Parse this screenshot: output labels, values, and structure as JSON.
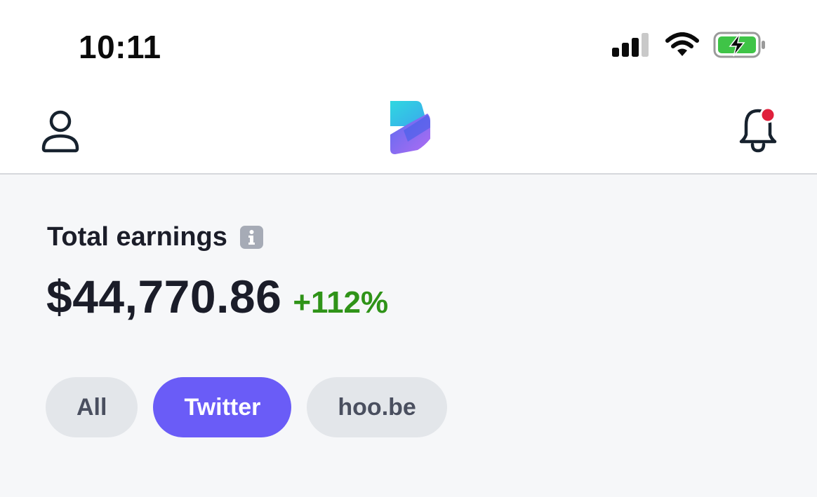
{
  "status_bar": {
    "time": "10:11",
    "icons": [
      "cellular-signal-icon",
      "wifi-icon",
      "battery-charging-icon"
    ]
  },
  "header": {
    "left_icon": "user-profile-icon",
    "logo": "app-logo",
    "right_icon": "notification-bell-icon",
    "has_unread_notification": true
  },
  "earnings": {
    "title": "Total earnings",
    "info_icon": "info-icon",
    "amount": "$44,770.86",
    "change": "+112%"
  },
  "filters": [
    {
      "label": "All",
      "active": false
    },
    {
      "label": "Twitter",
      "active": true
    },
    {
      "label": "hoo.be",
      "active": false
    }
  ],
  "colors": {
    "accent": "#6a5cf7",
    "positive": "#2f9318",
    "notification_dot": "#e0203c",
    "battery": "#3fc447"
  }
}
